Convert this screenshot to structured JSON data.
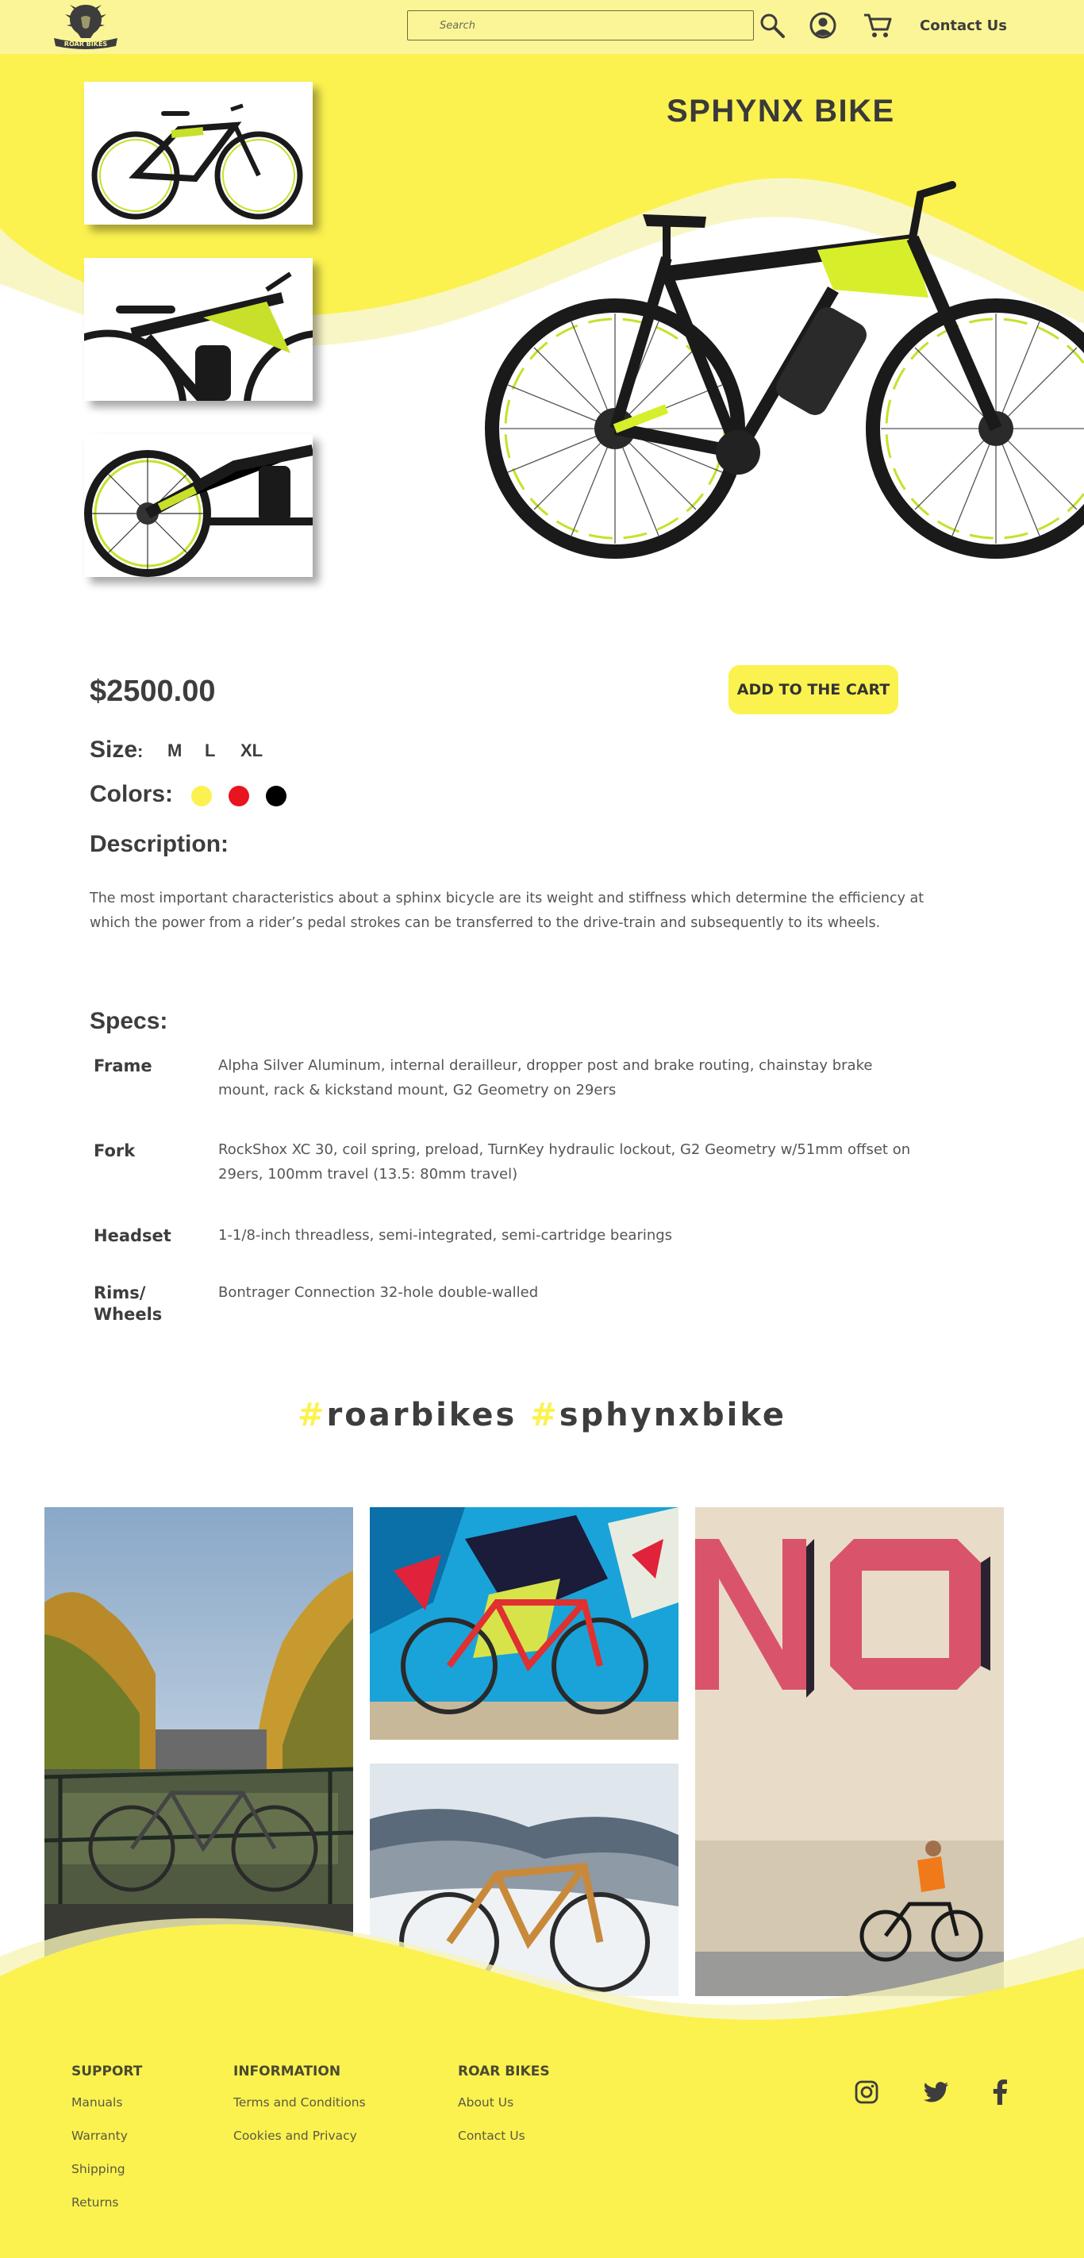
{
  "header": {
    "logo_text": "ROAR BIKES",
    "search_placeholder": "Search",
    "icons": [
      "search-icon",
      "user-icon",
      "cart-icon"
    ],
    "contact_label": "Contact Us"
  },
  "product": {
    "title": "SPHYNX BIKE",
    "price": "$2500.00",
    "add_to_cart_label": "ADD TO THE CART",
    "size_label": "Size",
    "size_colon": ":",
    "sizes": [
      "M",
      "L",
      "XL"
    ],
    "colors_label": "Colors:",
    "colors": [
      "#fbf250",
      "#e8141f",
      "#000000"
    ],
    "description_label": "Description:",
    "description": "The most important characteristics about a sphinx bicycle are its weight and stiffness which determine the efficiency at which the power from a rider’s pedal strokes can be transferred to the drive-train and subsequently to its wheels."
  },
  "specs": {
    "label": "Specs:",
    "items": [
      {
        "name": "Frame",
        "value": "Alpha Silver Aluminum, internal derailleur, dropper post and brake routing, chainstay brake mount, rack & kickstand mount, G2 Geometry on 29ers"
      },
      {
        "name": "Fork",
        "value": "RockShox XC 30, coil spring, preload, TurnKey hydraulic lockout, G2 Geometry w/51mm offset on 29ers, 100mm travel (13.5: 80mm travel)"
      },
      {
        "name": "Headset",
        "value": "1-1/8-inch threadless, semi-integrated, semi-cartridge bearings"
      },
      {
        "name": "Rims/ Wheels",
        "value": "Bontrager Connection 32-hole double-walled"
      }
    ]
  },
  "hashtags": {
    "hash": "#",
    "tag1": "roarbikes",
    "tag2": "sphynxbike"
  },
  "footer": {
    "columns": [
      {
        "heading": "SUPPORT",
        "links": [
          "Manuals",
          "Warranty",
          "Shipping",
          "Returns"
        ]
      },
      {
        "heading": "INFORMATION",
        "links": [
          "Terms and Conditions",
          "Cookies and Privacy"
        ]
      },
      {
        "heading": "ROAR BIKES",
        "links": [
          "About Us",
          "Contact Us"
        ]
      }
    ],
    "social": [
      "instagram-icon",
      "twitter-icon",
      "facebook-icon"
    ]
  },
  "colors": {
    "accent_yellow": "#fbf250",
    "header_yellow": "#fbf597",
    "text_dark": "#3d3d3d"
  }
}
